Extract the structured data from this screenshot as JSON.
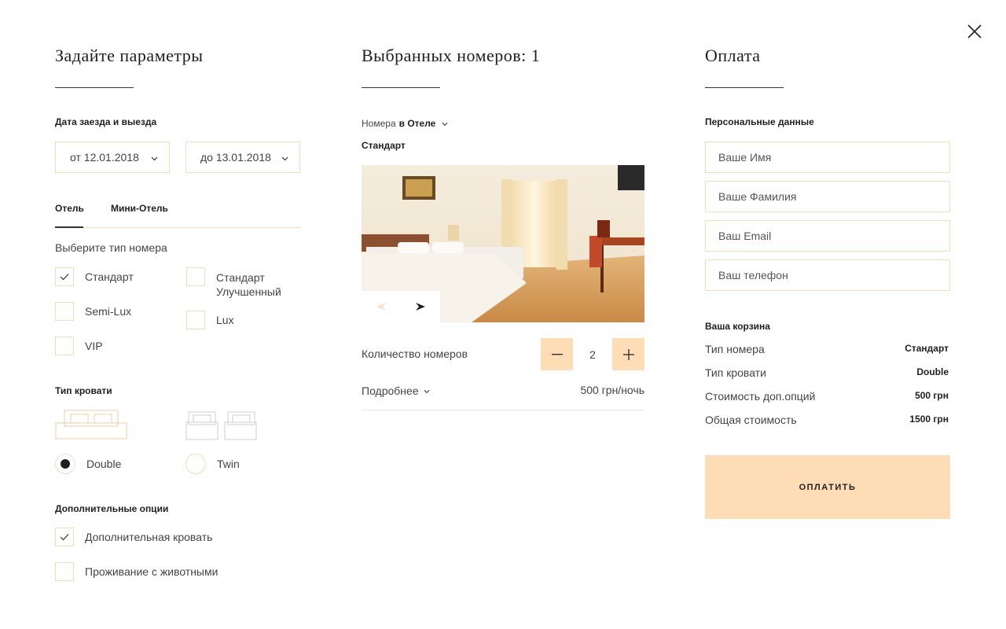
{
  "close_icon": "close-icon",
  "colors": {
    "accent": "#fddcb6",
    "border": "#f3dcb9",
    "text": "#1f1f1f"
  },
  "params": {
    "title": "Задайте параметры",
    "dates_label": "Дата заезда и выезда",
    "date_from": "от 12.01.2018",
    "date_to": "до 13.01.2018",
    "tabs": [
      {
        "label": "Отель",
        "active": true
      },
      {
        "label": "Мини-Отель",
        "active": false
      }
    ],
    "room_type_label": "Выберите тип номера",
    "room_types": [
      {
        "label": "Стандарт",
        "checked": true
      },
      {
        "label": "Стандарт",
        "label2": "Улучшенный",
        "checked": false
      },
      {
        "label": "Semi-Lux",
        "checked": false
      },
      {
        "label": "Lux",
        "checked": false
      },
      {
        "label": "VIP",
        "checked": false
      }
    ],
    "bed_type_label": "Тип кровати",
    "bed_types": [
      {
        "label": "Double",
        "selected": true
      },
      {
        "label": "Twin",
        "selected": false
      }
    ],
    "extra_label": "Дополнительные опции",
    "extras": [
      {
        "label": "Дополнительная кровать",
        "checked": true
      },
      {
        "label": "Проживание с животными",
        "checked": false
      }
    ]
  },
  "selected": {
    "title": "Выбранных номеров: 1",
    "filter_prefix": "Номера",
    "filter_value": "в Отеле",
    "room_name": "Стандарт",
    "quantity_label": "Количество номеров",
    "quantity": "2",
    "more_label": "Подробнее",
    "price": "500 грн/ночь"
  },
  "payment": {
    "title": "Оплата",
    "personal_label": "Персональные данные",
    "fields": {
      "name": "Ваше Имя",
      "surname": "Ваше Фамилия",
      "email": "Ваш Email",
      "phone": "Ваш телефон"
    },
    "cart_label": "Ваша корзина",
    "cart": [
      {
        "label": "Тип номера",
        "value": "Стандарт"
      },
      {
        "label": "Тип кровати",
        "value": "Double"
      },
      {
        "label": "Стоимость доп.опций",
        "value": "500 грн"
      },
      {
        "label": "Общая стоимость",
        "value": "1500 грн"
      }
    ],
    "pay_button": "ОПЛАТИТЬ"
  }
}
